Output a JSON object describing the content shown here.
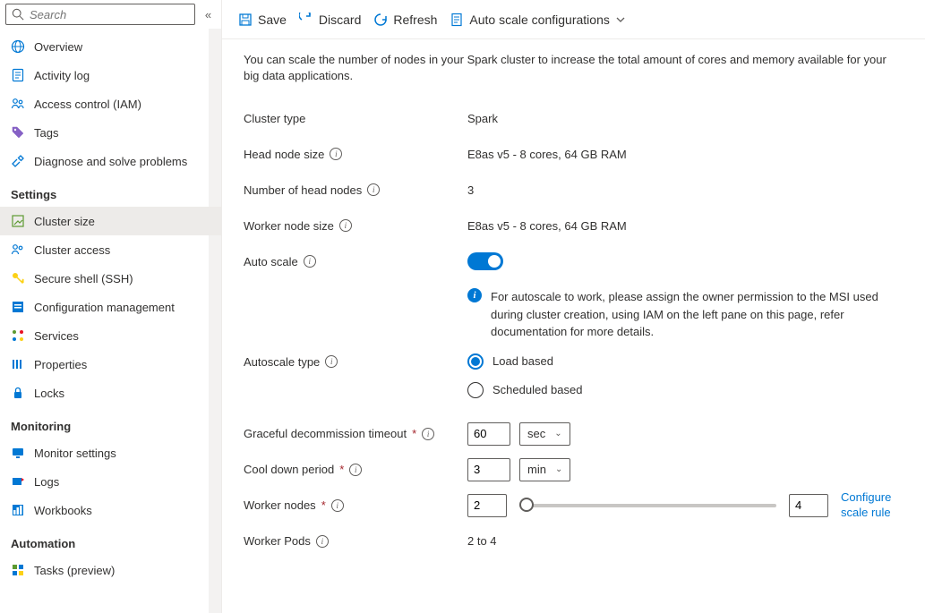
{
  "search": {
    "placeholder": "Search"
  },
  "nav": {
    "top": [
      {
        "label": "Overview"
      },
      {
        "label": "Activity log"
      },
      {
        "label": "Access control (IAM)"
      },
      {
        "label": "Tags"
      },
      {
        "label": "Diagnose and solve problems"
      }
    ],
    "sections": [
      {
        "title": "Settings",
        "items": [
          {
            "label": "Cluster size",
            "selected": true
          },
          {
            "label": "Cluster access"
          },
          {
            "label": "Secure shell (SSH)"
          },
          {
            "label": "Configuration management"
          },
          {
            "label": "Services"
          },
          {
            "label": "Properties"
          },
          {
            "label": "Locks"
          }
        ]
      },
      {
        "title": "Monitoring",
        "items": [
          {
            "label": "Monitor settings"
          },
          {
            "label": "Logs"
          },
          {
            "label": "Workbooks"
          }
        ]
      },
      {
        "title": "Automation",
        "items": [
          {
            "label": "Tasks (preview)"
          }
        ]
      }
    ]
  },
  "toolbar": {
    "save": "Save",
    "discard": "Discard",
    "refresh": "Refresh",
    "autoScale": "Auto scale configurations"
  },
  "content": {
    "description": "You can scale the number of nodes in your Spark cluster to increase the total amount of cores and memory available for your big data applications.",
    "clusterTypeLabel": "Cluster type",
    "clusterTypeValue": "Spark",
    "headNodeSizeLabel": "Head node size",
    "headNodeSizeValue": "E8as v5 - 8 cores, 64 GB RAM",
    "numHeadNodesLabel": "Number of head nodes",
    "numHeadNodesValue": "3",
    "workerNodeSizeLabel": "Worker node size",
    "workerNodeSizeValue": "E8as v5 - 8 cores, 64 GB RAM",
    "autoScaleLabel": "Auto scale",
    "notice": "For autoscale to work, please assign the owner permission to the MSI used during cluster creation, using IAM on the left pane on this page, refer documentation for more details.",
    "autoscaleTypeLabel": "Autoscale type",
    "radioLoad": "Load based",
    "radioScheduled": "Scheduled based",
    "gracefulLabel": "Graceful decommission timeout",
    "gracefulValue": "60",
    "gracefulUnit": "sec",
    "cooldownLabel": "Cool down period",
    "cooldownValue": "3",
    "cooldownUnit": "min",
    "workerNodesLabel": "Worker nodes",
    "workerMin": "2",
    "workerMax": "4",
    "configureLink": "Configure scale rule",
    "workerPodsLabel": "Worker Pods",
    "workerPodsValue": "2 to 4"
  }
}
